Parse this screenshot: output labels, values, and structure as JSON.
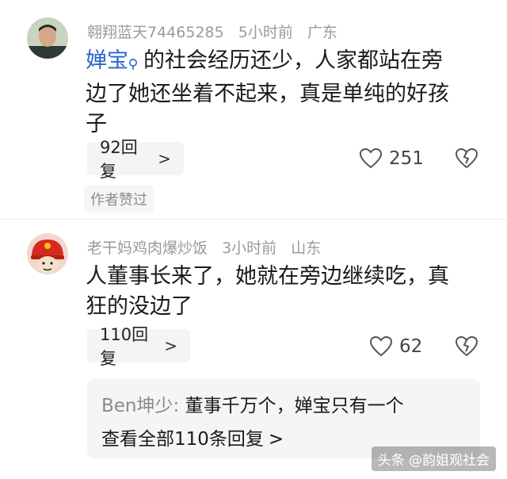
{
  "comments": [
    {
      "username": "翱翔蓝天74465285",
      "time": "5小时前",
      "location": "广东",
      "mention": "婵宝",
      "mention_icon": "search-icon",
      "text_line1": "的社会经历还少，人家都站在旁",
      "text_line2": "边了她还坐着不起来，真是单纯的好孩",
      "text_line3": "子",
      "replies_label": "92回复",
      "likes": "251",
      "author_liked": "作者赞过"
    },
    {
      "username": "老干妈鸡肉爆炒饭",
      "time": "3小时前",
      "location": "山东",
      "text_line1": "人董事长来了，她就在旁边继续吃，真",
      "text_line2": "狂的没边了",
      "replies_label": "110回复",
      "likes": "62",
      "reply_preview": {
        "name": "Ben坤少:",
        "text": "董事千万个，婵宝只有一个",
        "view_all": "查看全部110条回复"
      }
    }
  ],
  "watermark": "头条 @韵姐观社会",
  "colors": {
    "mention": "#2a66c9",
    "meta": "#9a9a9a",
    "pill_bg": "#f4f4f4"
  }
}
